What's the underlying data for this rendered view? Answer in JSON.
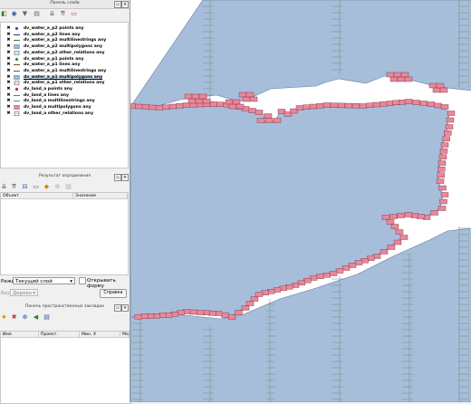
{
  "layers_panel": {
    "title": "Панель слоёв",
    "layers": [
      {
        "name": "dv_water_a_p2 points any",
        "symbol": "point",
        "color": "#6a3fa0"
      },
      {
        "name": "dv_water_a_p2 lines any",
        "symbol": "line",
        "color": "#2a2a8a"
      },
      {
        "name": "dv_water_a_p2 multilinestrings any",
        "symbol": "line",
        "color": "#3a7a2a"
      },
      {
        "name": "dv_water_a_p2 multipolygons any",
        "symbol": "fill",
        "color": "#9ab7d8"
      },
      {
        "name": "dv_water_a_p2 other_relations any",
        "symbol": "table",
        "color": "#666666"
      },
      {
        "name": "dv_water_a_p1 points any",
        "symbol": "point",
        "color": "#3a8a3a"
      },
      {
        "name": "dv_water_a_p1 lines any",
        "symbol": "line",
        "color": "#7a4a2a"
      },
      {
        "name": "dv_water_a_p1 multilinestrings any",
        "symbol": "line",
        "color": "#2a6a8a"
      },
      {
        "name": "dv_water_a_p1 multipolygons any",
        "symbol": "fill",
        "color": "#9ab7d8",
        "selected": true
      },
      {
        "name": "dv_water_a_p1 other_relations any",
        "symbol": "table",
        "color": "#666666"
      },
      {
        "name": "dv_land_a points any",
        "symbol": "point",
        "color": "#c03060"
      },
      {
        "name": "dv_land_a lines any",
        "symbol": "line",
        "color": "#9a6a3a"
      },
      {
        "name": "dv_land_a multilinestrings any",
        "symbol": "line",
        "color": "#5a8a9a"
      },
      {
        "name": "dv_land_a multipolygons any",
        "symbol": "fill",
        "color": "#e8889a"
      },
      {
        "name": "dv_land_a other_relations any",
        "symbol": "table",
        "color": "#666666"
      }
    ]
  },
  "identify_panel": {
    "title": "Результат определения",
    "columns": [
      "Объект",
      "Значение"
    ],
    "mode_label": "Режим",
    "mode_value": "Текущий слой",
    "open_form_label": "Открывать форму",
    "view_label": "Вид",
    "view_value": "Дерево",
    "help_button": "Справка"
  },
  "bookmarks_panel": {
    "title": "Панель пространственных закладок",
    "columns": [
      "Имя",
      "Проект",
      "Мин. X",
      "Ма"
    ]
  },
  "colors": {
    "water": "#a7bedb",
    "land": "#e8889a",
    "grid": "#6f8f7a"
  }
}
